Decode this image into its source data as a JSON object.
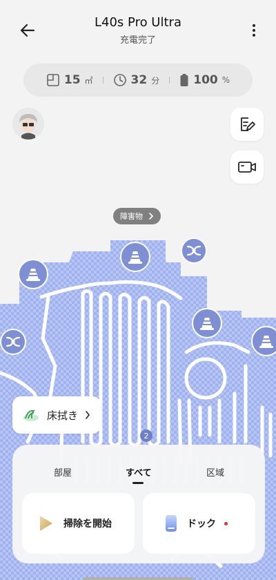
{
  "header": {
    "title": "L40s Pro Ultra",
    "status": "充電完了",
    "back_icon": "arrow-left-icon",
    "more_icon": "more-vertical-icon"
  },
  "stats": {
    "area_value": "15",
    "area_unit": "㎡",
    "time_value": "32",
    "time_unit": "分",
    "battery_value": "100",
    "battery_unit": "%"
  },
  "map": {
    "tooltip": "障害物",
    "badge": "2",
    "colors": {
      "floor": "#a9baf0",
      "floor_light": "#c4d0f6",
      "marker": "#7f8fd3",
      "path": "#ffffff"
    }
  },
  "mop_chip": {
    "label": "床拭き"
  },
  "panel": {
    "tabs": [
      "部屋",
      "すべて",
      "区域"
    ],
    "active_tab": "すべて",
    "start_label": "掃除を開始",
    "dock_label": "ドック"
  }
}
